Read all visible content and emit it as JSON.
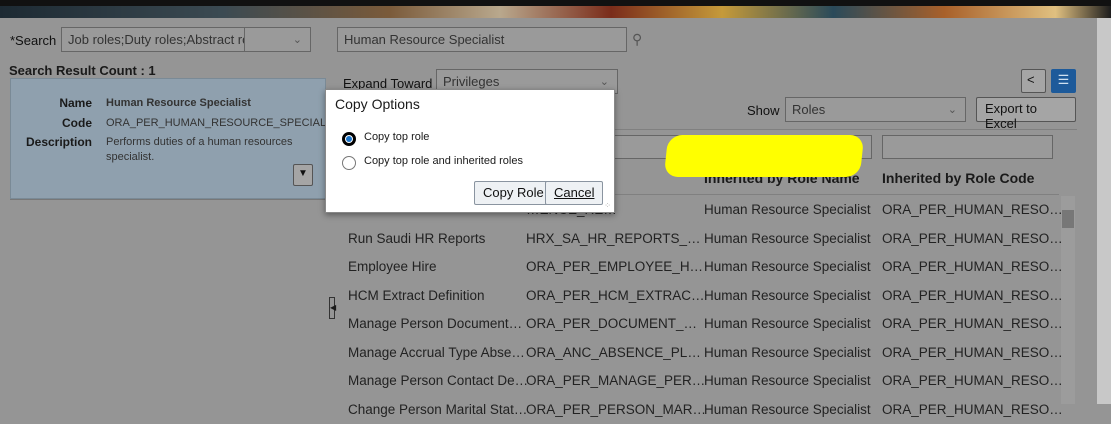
{
  "search": {
    "label": "*Search",
    "type_value": "Job roles;Duty roles;Abstract roles;Otl",
    "keyword": "Human Resource Specialist"
  },
  "result_count": "Search Result Count : 1",
  "result": {
    "name_label": "Name",
    "name": "Human Resource Specialist",
    "code_label": "Code",
    "code": "ORA_PER_HUMAN_RESOURCE_SPECIALIST_JO",
    "desc_label": "Description",
    "desc": "Performs duties of a human resources specialist."
  },
  "expand": {
    "label": "Expand Toward",
    "value": "Privileges"
  },
  "show": {
    "label": "Show",
    "value": "Roles"
  },
  "export_label": "Export to Excel",
  "columns": [
    "Inherited by Role Name",
    "Inherited by Role Code"
  ],
  "rows": [
    [
      "",
      "…ENCE_RE…",
      "Human Resource Specialist",
      "ORA_PER_HUMAN_RESO…"
    ],
    [
      "Run Saudi HR Reports",
      "HRX_SA_HR_REPORTS_…",
      "Human Resource Specialist",
      "ORA_PER_HUMAN_RESO…"
    ],
    [
      "Employee Hire",
      "ORA_PER_EMPLOYEE_H…",
      "Human Resource Specialist",
      "ORA_PER_HUMAN_RESO…"
    ],
    [
      "HCM Extract Definition",
      "ORA_PER_HCM_EXTRAC…",
      "Human Resource Specialist",
      "ORA_PER_HUMAN_RESO…"
    ],
    [
      "Manage Person Document…",
      "ORA_PER_DOCUMENT_…",
      "Human Resource Specialist",
      "ORA_PER_HUMAN_RESO…"
    ],
    [
      "Manage Accrual Type Abse…",
      "ORA_ANC_ABSENCE_PL…",
      "Human Resource Specialist",
      "ORA_PER_HUMAN_RESO…"
    ],
    [
      "Manage Person Contact De…",
      "ORA_PER_MANAGE_PER…",
      "Human Resource Specialist",
      "ORA_PER_HUMAN_RESO…"
    ],
    [
      "Change Person Marital Stat…",
      "ORA_PER_PERSON_MAR…",
      "Human Resource Specialist",
      "ORA_PER_HUMAN_RESO…"
    ]
  ],
  "dialog": {
    "title": "Copy Options",
    "option1": "Copy top role",
    "option2": "Copy top role and inherited roles",
    "copy_label": "Copy Role",
    "cancel_label": "Cancel"
  }
}
